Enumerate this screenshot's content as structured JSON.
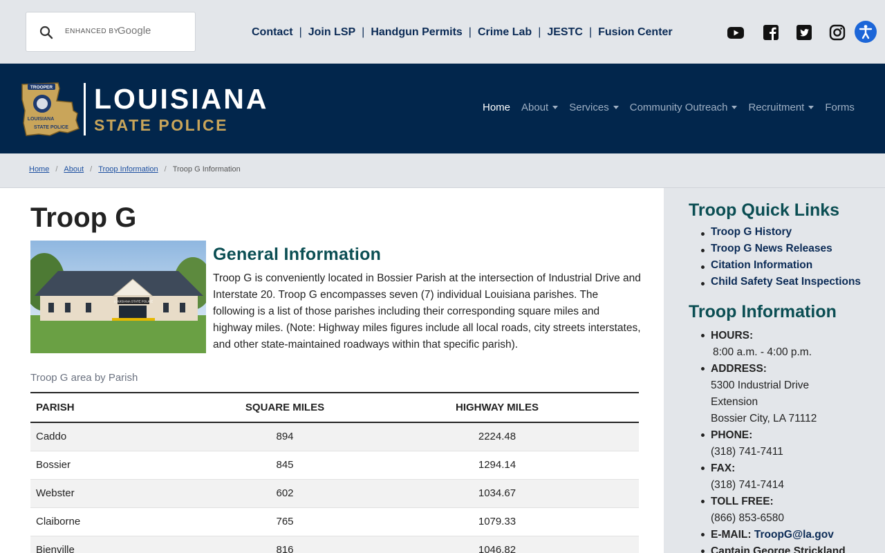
{
  "search": {
    "enhanced_by": "ENHANCED BY",
    "google": "Google"
  },
  "utility_links": [
    "Contact",
    "Join LSP",
    "Handgun Permits",
    "Crime Lab",
    "JESTC",
    "Fusion Center"
  ],
  "social_icons": [
    "youtube-icon",
    "facebook-icon",
    "twitter-icon",
    "instagram-icon",
    "accessibility-icon"
  ],
  "logo": {
    "title": "LOUISIANA",
    "subtitle": "STATE POLICE",
    "badge_top": "TROOPER",
    "badge_mid": "LOUISIANA",
    "badge_bottom": "STATE POLICE"
  },
  "nav": [
    {
      "label": "Home",
      "active": true,
      "dropdown": false
    },
    {
      "label": "About",
      "active": false,
      "dropdown": true
    },
    {
      "label": "Services",
      "active": false,
      "dropdown": true
    },
    {
      "label": "Community Outreach",
      "active": false,
      "dropdown": true
    },
    {
      "label": "Recruitment",
      "active": false,
      "dropdown": true
    },
    {
      "label": "Forms",
      "active": false,
      "dropdown": false
    }
  ],
  "breadcrumb": {
    "home": "Home",
    "about": "About",
    "troop_info": "Troop Information",
    "current": "Troop G Information"
  },
  "page": {
    "title": "Troop G",
    "general_heading": "General Information",
    "general_text": "Troop G is conveniently located in Bossier Parish at the intersection of Industrial Drive and Interstate 20. Troop G encompasses seven (7) individual Louisiana parishes. The following is a list of those parishes including their corresponding square miles and highway miles. (Note: Highway miles figures include all local roads, city streets interstates, and other state-maintained roadways within that specific parish).",
    "table_caption": "Troop G area by Parish",
    "photo_sign": "LOUISIANA STATE POLICE"
  },
  "table": {
    "headers": [
      "PARISH",
      "SQUARE MILES",
      "HIGHWAY MILES"
    ],
    "rows": [
      [
        "Caddo",
        "894",
        "2224.48"
      ],
      [
        "Bossier",
        "845",
        "1294.14"
      ],
      [
        "Webster",
        "602",
        "1034.67"
      ],
      [
        "Claiborne",
        "765",
        "1079.33"
      ],
      [
        "Bienville",
        "816",
        "1046.82"
      ]
    ]
  },
  "sidebar": {
    "quick_links_heading": "Troop Quick Links",
    "quick_links": [
      "Troop G History",
      "Troop G News Releases",
      "Citation Information",
      "Child Safety Seat Inspections"
    ],
    "info_heading": "Troop Information",
    "hours_label": "HOURS:",
    "hours": "8:00 a.m. - 4:00 p.m.",
    "address_label": "ADDRESS:",
    "address_line1": "5300 Industrial Drive",
    "address_line2": "Extension",
    "address_line3": "Bossier City, LA 71112",
    "phone_label": "PHONE:",
    "phone": "(318) 741-7411",
    "fax_label": "FAX:",
    "fax": "(318) 741-7414",
    "tollfree_label": "TOLL FREE:",
    "tollfree": "(866) 853-6580",
    "email_label": "E-MAIL:",
    "email": "TroopG@la.gov",
    "captain": "Captain George Strickland"
  },
  "colors": {
    "navy": "#02264c",
    "gold": "#c9a55a",
    "teal": "#0b4e53",
    "link": "#0a2a55",
    "accessibility": "#1c66d8"
  }
}
